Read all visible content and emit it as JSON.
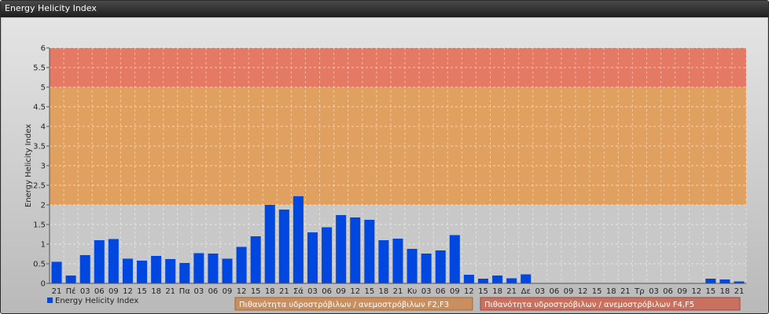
{
  "window": {
    "title": "Energy Helicity Index"
  },
  "chart_data": {
    "type": "bar",
    "ylabel": "Energy Helicity Index",
    "ylim": [
      0,
      6
    ],
    "yticks": [
      "0",
      "0.5",
      "1",
      "1.5",
      "2",
      "2.5",
      "3",
      "3.5",
      "4",
      "4.5",
      "5",
      "5.5",
      "6"
    ],
    "grid": true,
    "legend_position": "bottom-left",
    "categories": [
      "21",
      "Πέ",
      "03",
      "06",
      "09",
      "12",
      "15",
      "18",
      "21",
      "Πα",
      "03",
      "06",
      "09",
      "12",
      "15",
      "18",
      "21",
      "Σά",
      "03",
      "06",
      "09",
      "12",
      "15",
      "18",
      "21",
      "Κυ",
      "03",
      "06",
      "09",
      "12",
      "15",
      "18",
      "21",
      "Δε",
      "03",
      "06",
      "09",
      "12",
      "15",
      "18",
      "21",
      "Τρ",
      "03",
      "06",
      "09",
      "12",
      "15",
      "18",
      "21"
    ],
    "series": [
      {
        "name": "Energy Helicity Index",
        "color": "#0047e0",
        "values": [
          0.55,
          0.2,
          0.72,
          1.1,
          1.13,
          0.63,
          0.58,
          0.7,
          0.62,
          0.52,
          0.77,
          0.76,
          0.63,
          0.93,
          1.2,
          2.0,
          1.88,
          2.22,
          1.3,
          1.43,
          1.74,
          1.68,
          1.62,
          1.1,
          1.14,
          0.88,
          0.76,
          0.84,
          1.23,
          0.22,
          0.12,
          0.2,
          0.13,
          0.23,
          0.01,
          0.01,
          0.01,
          0.01,
          0.01,
          0.01,
          0.01,
          0.01,
          0.01,
          0.01,
          0.01,
          0.01,
          0.12,
          0.1,
          0.05
        ]
      }
    ],
    "bands": [
      {
        "from": 2,
        "to": 5,
        "color": "#e0a060",
        "label": "Πιθανότητα υδροστρόβιλων / ανεμοστρόβιλων F2,F3"
      },
      {
        "from": 5,
        "to": 6,
        "color": "#e47a64",
        "label": "Πιθανότητα υδροστρόβιλων / ανεμοστρόβιλων F4,F5"
      }
    ]
  }
}
